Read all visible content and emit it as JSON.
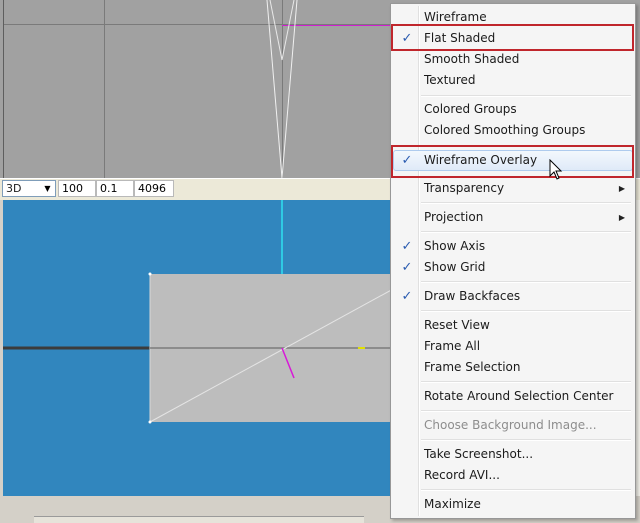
{
  "toolbar": {
    "view_mode": "3D",
    "field1": "100",
    "field2": "0.1",
    "field3": "4096"
  },
  "menu": {
    "items": [
      {
        "label": "Wireframe",
        "checked": false
      },
      {
        "label": "Flat Shaded",
        "checked": true
      },
      {
        "label": "Smooth Shaded",
        "checked": false
      },
      {
        "label": "Textured",
        "checked": false
      },
      {
        "label": "Colored Groups",
        "checked": false
      },
      {
        "label": "Colored Smoothing Groups",
        "checked": false
      },
      {
        "label": "Wireframe Overlay",
        "checked": true
      },
      {
        "label": "Transparency",
        "submenu": true
      },
      {
        "label": "Projection",
        "submenu": true
      },
      {
        "label": "Show Axis",
        "checked": true
      },
      {
        "label": "Show Grid",
        "checked": true
      },
      {
        "label": "Draw Backfaces",
        "checked": true
      },
      {
        "label": "Reset View",
        "checked": false
      },
      {
        "label": "Frame All",
        "checked": false
      },
      {
        "label": "Frame Selection",
        "checked": false
      },
      {
        "label": "Rotate Around Selection Center",
        "checked": false
      },
      {
        "label": "Choose Background Image...",
        "disabled": true
      },
      {
        "label": "Take Screenshot...",
        "checked": false
      },
      {
        "label": "Record AVI...",
        "checked": false
      },
      {
        "label": "Maximize",
        "checked": false
      }
    ]
  },
  "icons": {
    "check": "check-icon",
    "submenu": "submenu-arrow-icon",
    "cursor": "mouse-pointer-icon"
  },
  "colors": {
    "viewport_3d_bg": "#3186be",
    "viewport_2d_bg": "#a1a1a1",
    "highlight_border": "#c0262c",
    "check_color": "#2a5bb0"
  }
}
